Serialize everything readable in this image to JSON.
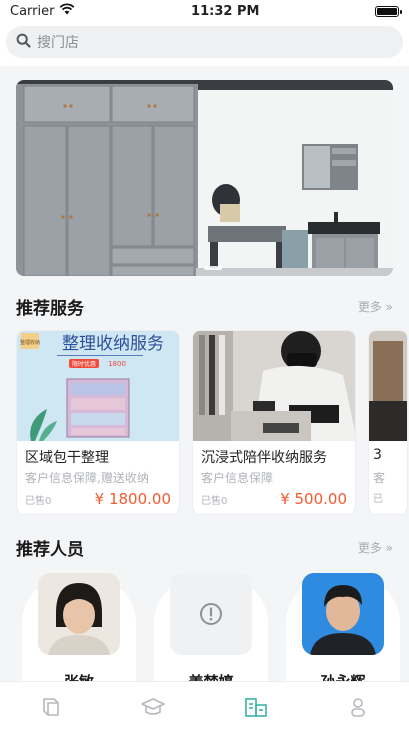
{
  "status_bar": {
    "carrier": "Carrier",
    "time": "11:32 PM"
  },
  "search": {
    "placeholder": "搜门店"
  },
  "banner": {
    "description_icon": "photo"
  },
  "recommended_services": {
    "title": "推荐服务",
    "more": "更多 »",
    "items": [
      {
        "title": "区域包干整理",
        "desc": "客户信息保障,赠送收纳",
        "sold": "已售0",
        "price": "¥ 1800.00",
        "poster_title": "整理收纳服务",
        "poster_tag": "限时优惠",
        "poster_price": "1800",
        "poster_badge": "整理收纳"
      },
      {
        "title": "沉浸式陪伴收纳服务",
        "desc": "客户信息保障",
        "sold": "已售0",
        "price": "¥ 500.00"
      },
      {
        "title": "3",
        "desc": "客",
        "sold": "已",
        "price": ""
      }
    ]
  },
  "recommended_staff": {
    "title": "推荐人员",
    "more": "更多 »",
    "items": [
      {
        "name": "张敏"
      },
      {
        "name": "姜梦婷"
      },
      {
        "name": "孙永辉"
      }
    ]
  },
  "tab_bar": {
    "items": [
      "book-icon",
      "graduation-cap-icon",
      "store-icon",
      "profile-icon"
    ],
    "active_index": 2,
    "active_color": "#3cb3a7",
    "inactive_color": "#b5b8bd"
  }
}
